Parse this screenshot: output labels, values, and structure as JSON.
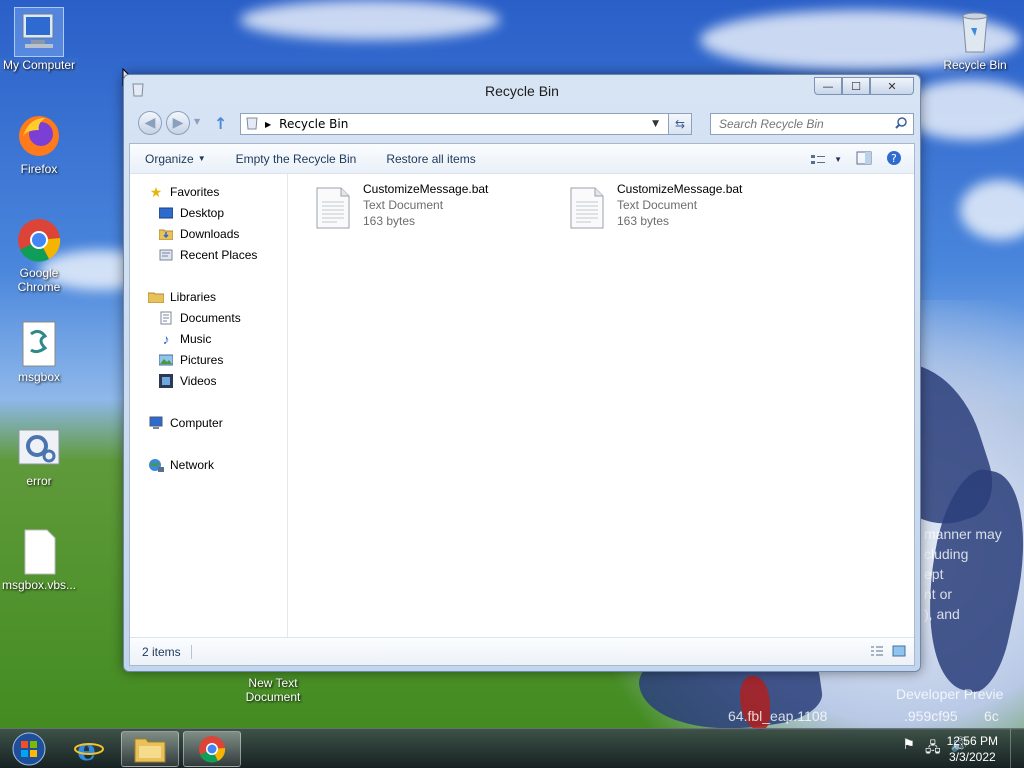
{
  "desktop": {
    "icons": [
      {
        "label": "My Computer"
      },
      {
        "label": "Firefox"
      },
      {
        "label": "Google Chrome"
      },
      {
        "label": "msgbox"
      },
      {
        "label": "error"
      },
      {
        "label": "msgbox.vbs..."
      },
      {
        "label": "Recycle Bin"
      },
      {
        "label": "New Text Document"
      }
    ],
    "overlay_lines": [
      "manner may",
      "cluding",
      "ept",
      "nt or",
      "), and",
      "Developer Previe",
      "64.fbl_eap.1108",
      ".959cf95",
      "6c"
    ]
  },
  "window": {
    "title": "Recycle Bin",
    "controls": {
      "minimize": "—",
      "maximize": "☐",
      "close": "✕"
    },
    "address": {
      "path": "Recycle Bin"
    },
    "search": {
      "placeholder": "Search Recycle Bin"
    },
    "commands": {
      "organize": "Organize",
      "empty": "Empty the Recycle Bin",
      "restore": "Restore all items"
    },
    "nav": {
      "favorites": "Favorites",
      "desktop": "Desktop",
      "downloads": "Downloads",
      "recent": "Recent Places",
      "libraries": "Libraries",
      "documents": "Documents",
      "music": "Music",
      "pictures": "Pictures",
      "videos": "Videos",
      "computer": "Computer",
      "network": "Network"
    },
    "files": [
      {
        "name": "CustomizeMessage.bat",
        "type": "Text Document",
        "size": "163 bytes"
      },
      {
        "name": "CustomizeMessage.bat",
        "type": "Text Document",
        "size": "163 bytes"
      }
    ],
    "status": {
      "count": "2 items"
    }
  },
  "taskbar": {
    "time": "12:56 PM",
    "date": "3/3/2022"
  }
}
